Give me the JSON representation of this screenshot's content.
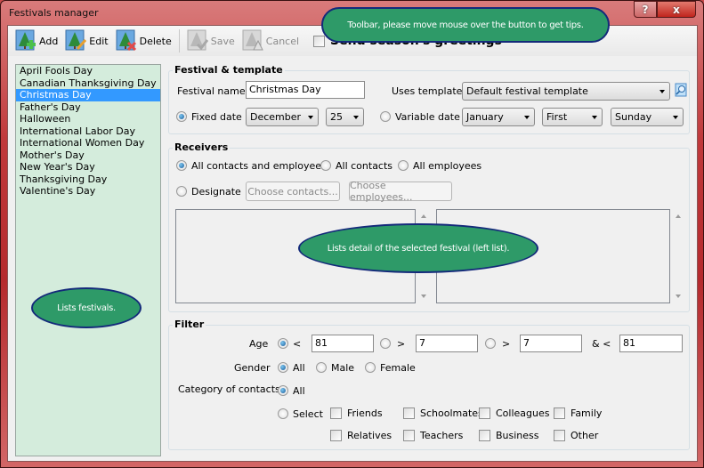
{
  "window": {
    "title": "Festivals manager",
    "help_label": "?",
    "close_label": "x"
  },
  "toolbar": {
    "buttons": [
      {
        "label": "Add",
        "icon": "tree-add-icon",
        "enabled": true
      },
      {
        "label": "Edit",
        "icon": "tree-edit-icon",
        "enabled": true
      },
      {
        "label": "Delete",
        "icon": "tree-delete-icon",
        "enabled": true
      },
      {
        "label": "Save",
        "icon": "tree-save-icon",
        "enabled": false
      },
      {
        "label": "Cancel",
        "icon": "tree-cancel-icon",
        "enabled": false
      }
    ],
    "send_greetings": {
      "label": "Send season's greetings",
      "checked": false
    }
  },
  "festivals": {
    "items": [
      "April Fools Day",
      "Canadian Thanksgiving Day",
      "Christmas Day",
      "Father's Day",
      "Halloween",
      "International Labor Day",
      "International Women Day",
      "Mother's Day",
      "New Year's Day",
      "Thanksgiving Day",
      "Valentine's Day"
    ],
    "selected": "Christmas Day"
  },
  "festival_template": {
    "title": "Festival & template",
    "name_label": "Festival name",
    "name_value": "Christmas Day",
    "template_label": "Uses template",
    "template_value": "Default festival template",
    "fixed_date_label": "Fixed date",
    "fixed_month": "December",
    "fixed_day": "25",
    "variable_date_label": "Variable date",
    "variable_month": "January",
    "variable_week": "First",
    "variable_weekday": "Sunday",
    "date_mode": "fixed"
  },
  "receivers": {
    "title": "Receivers",
    "options": [
      "All contacts and employees",
      "All contacts",
      "All employees",
      "Designate"
    ],
    "selected": "All contacts and employees",
    "choose_contacts_label": "Choose contacts...",
    "choose_employees_label": "Choose employees..."
  },
  "filter": {
    "title": "Filter",
    "age_label": "Age",
    "age_lt_symbol": "<",
    "age_lt_value": "81",
    "age_gt_symbol": ">",
    "age_gt_value": "7",
    "age_between_gt_symbol": ">",
    "age_between_gt_value": "7",
    "age_between_lt_symbol": "& <",
    "age_between_lt_value": "81",
    "age_mode": "less-than",
    "gender_label": "Gender",
    "gender_options": [
      "All",
      "Male",
      "Female"
    ],
    "gender_selected": "All",
    "category_label": "Category of contacts",
    "category_all_label": "All",
    "category_select_label": "Select",
    "category_selected": "All",
    "categories": [
      "Friends",
      "Schoolmates",
      "Colleagues",
      "Family",
      "Relatives",
      "Teachers",
      "Business",
      "Other"
    ]
  },
  "callouts": {
    "toolbar": "Toolbar, please move mouse over the button to get tips.",
    "details": "Lists detail of the selected festival (left list).",
    "festivals": "Lists festivals."
  }
}
